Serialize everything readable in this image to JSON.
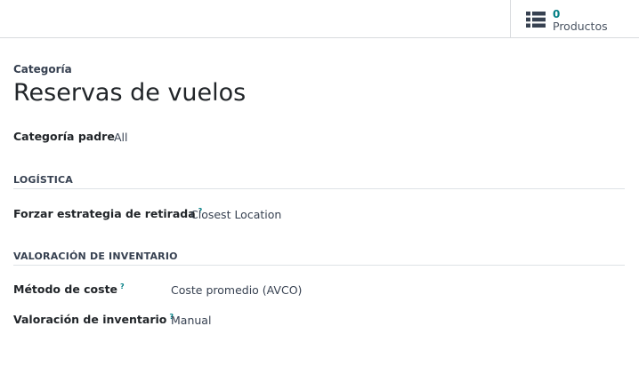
{
  "smart_button": {
    "value": "0",
    "label": "Productos",
    "icon": "list-icon"
  },
  "record": {
    "kind_label": "Categoría",
    "title": "Reservas de vuelos"
  },
  "fields": {
    "parent": {
      "label": "Categoría padre",
      "value": "All"
    }
  },
  "groups": {
    "logistics": {
      "title": "LOGÍSTICA",
      "removal_strategy": {
        "label": "Forzar estrategia de retirada",
        "help": "?",
        "value": "Closest Location"
      }
    },
    "valuation": {
      "title": "VALORACIÓN DE INVENTARIO",
      "cost_method": {
        "label": "Método de coste",
        "help": "?",
        "value": "Coste promedio (AVCO)"
      },
      "inventory_valuation": {
        "label": "Valoración de inventario",
        "help": "?",
        "value": "Manual"
      }
    }
  },
  "colors": {
    "accent": "#017e84",
    "border": "#d8dadd",
    "text": "#374151"
  }
}
